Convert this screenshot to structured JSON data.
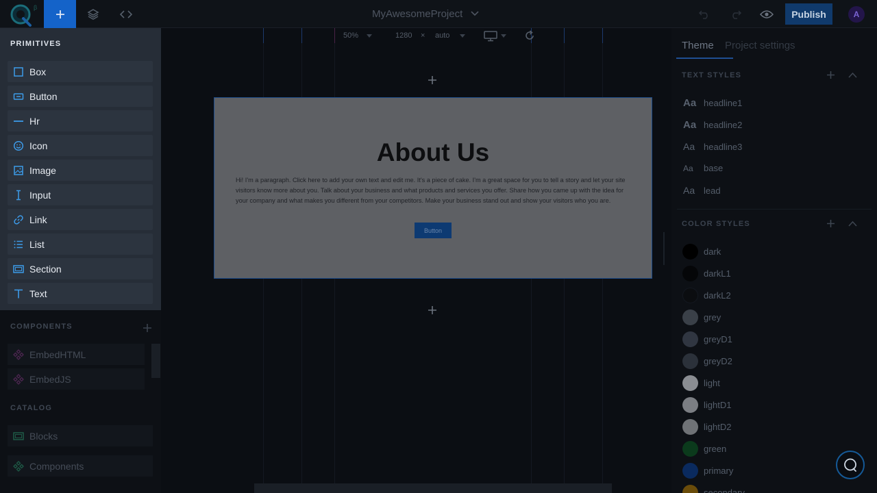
{
  "app": {
    "logo_badge": "β",
    "project_name": "MyAwesomeProject",
    "publish_label": "Publish",
    "avatar_initial": "A"
  },
  "left": {
    "primitives_title": "PRIMITIVES",
    "primitives": [
      {
        "label": "Box",
        "icon": "box-icon"
      },
      {
        "label": "Button",
        "icon": "button-icon"
      },
      {
        "label": "Hr",
        "icon": "hr-icon"
      },
      {
        "label": "Icon",
        "icon": "smiley-icon"
      },
      {
        "label": "Image",
        "icon": "image-icon"
      },
      {
        "label": "Input",
        "icon": "text-cursor-icon"
      },
      {
        "label": "Link",
        "icon": "link-icon"
      },
      {
        "label": "List",
        "icon": "list-icon"
      },
      {
        "label": "Section",
        "icon": "section-icon"
      },
      {
        "label": "Text",
        "icon": "text-icon"
      }
    ],
    "components_title": "COMPONENTS",
    "components": [
      {
        "label": "EmbedHTML",
        "icon": "component-icon"
      },
      {
        "label": "EmbedJS",
        "icon": "component-icon"
      }
    ],
    "catalog_title": "CATALOG",
    "catalog": [
      {
        "label": "Blocks",
        "icon": "blocks-icon"
      },
      {
        "label": "Components",
        "icon": "component-icon"
      }
    ]
  },
  "canvas": {
    "zoom": "50%",
    "width": "1280",
    "times": "×",
    "height": "auto",
    "page": {
      "heading": "About Us",
      "paragraph": "Hi! I'm a paragraph. Click here to add your own text and edit me. It's a piece of cake. I'm a great space for you to tell a story and let your site visitors know more about you. Talk about your business and what products and services you offer. Share how you came up with the idea for your company and what makes you different from your competitors. Make your business stand out and show your visitors who you are.",
      "button_label": "Button"
    }
  },
  "right": {
    "tabs": [
      "Theme",
      "Project settings"
    ],
    "text_styles_title": "TEXT STYLES",
    "text_styles": [
      {
        "aa": "Aa",
        "name": "headline1"
      },
      {
        "aa": "Aa",
        "name": "headline2"
      },
      {
        "aa": "Aa",
        "name": "headline3"
      },
      {
        "aa": "Aa",
        "name": "base"
      },
      {
        "aa": "Aa",
        "name": "lead"
      }
    ],
    "color_styles_title": "COLOR STYLES",
    "color_styles": [
      {
        "name": "dark",
        "color": "#000000"
      },
      {
        "name": "darkL1",
        "color": "#050608"
      },
      {
        "name": "darkL2",
        "color": "#0b0d10"
      },
      {
        "name": "grey",
        "color": "#3a4048"
      },
      {
        "name": "greyD1",
        "color": "#303641"
      },
      {
        "name": "greyD2",
        "color": "#2b313a"
      },
      {
        "name": "light",
        "color": "#8a8d92"
      },
      {
        "name": "lightD1",
        "color": "#7b7e83"
      },
      {
        "name": "lightD2",
        "color": "#6f7276"
      },
      {
        "name": "green",
        "color": "#0b3a1c"
      },
      {
        "name": "primary",
        "color": "#0a2a5e"
      },
      {
        "name": "secondary",
        "color": "#6a4c0a"
      }
    ]
  },
  "colors": {
    "accent": "#1463c9",
    "primitive_icon": "#3d9be9"
  }
}
